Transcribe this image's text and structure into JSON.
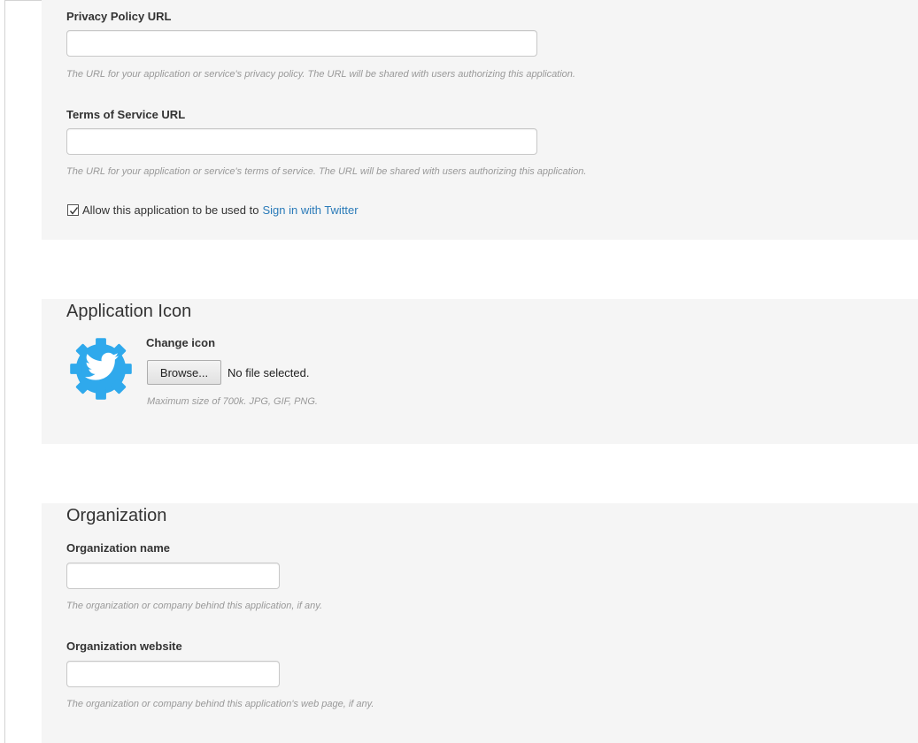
{
  "details": {
    "privacy_policy": {
      "label": "Privacy Policy URL",
      "value": "",
      "hint": "The URL for your application or service's privacy policy. The URL will be shared with users authorizing this application."
    },
    "terms_of_service": {
      "label": "Terms of Service URL",
      "value": "",
      "hint": "The URL for your application or service's terms of service. The URL will be shared with users authorizing this application."
    },
    "sign_in": {
      "checked": true,
      "label": "Allow this application to be used to",
      "link": "Sign in with Twitter"
    }
  },
  "application_icon": {
    "title": "Application Icon",
    "change_label": "Change icon",
    "browse_label": "Browse...",
    "file_status": "No file selected.",
    "hint": "Maximum size of 700k. JPG, GIF, PNG.",
    "icon_name": "twitter-gear-icon"
  },
  "organization": {
    "title": "Organization",
    "name": {
      "label": "Organization name",
      "value": "",
      "hint": "The organization or company behind this application, if any."
    },
    "website": {
      "label": "Organization website",
      "value": "",
      "hint": "The organization or company behind this application's web page, if any."
    }
  },
  "colors": {
    "panel_background": "#f5f5f5",
    "link": "#2b7bb9",
    "icon_blue": "#2fa9ec",
    "hint_text": "#999999"
  }
}
